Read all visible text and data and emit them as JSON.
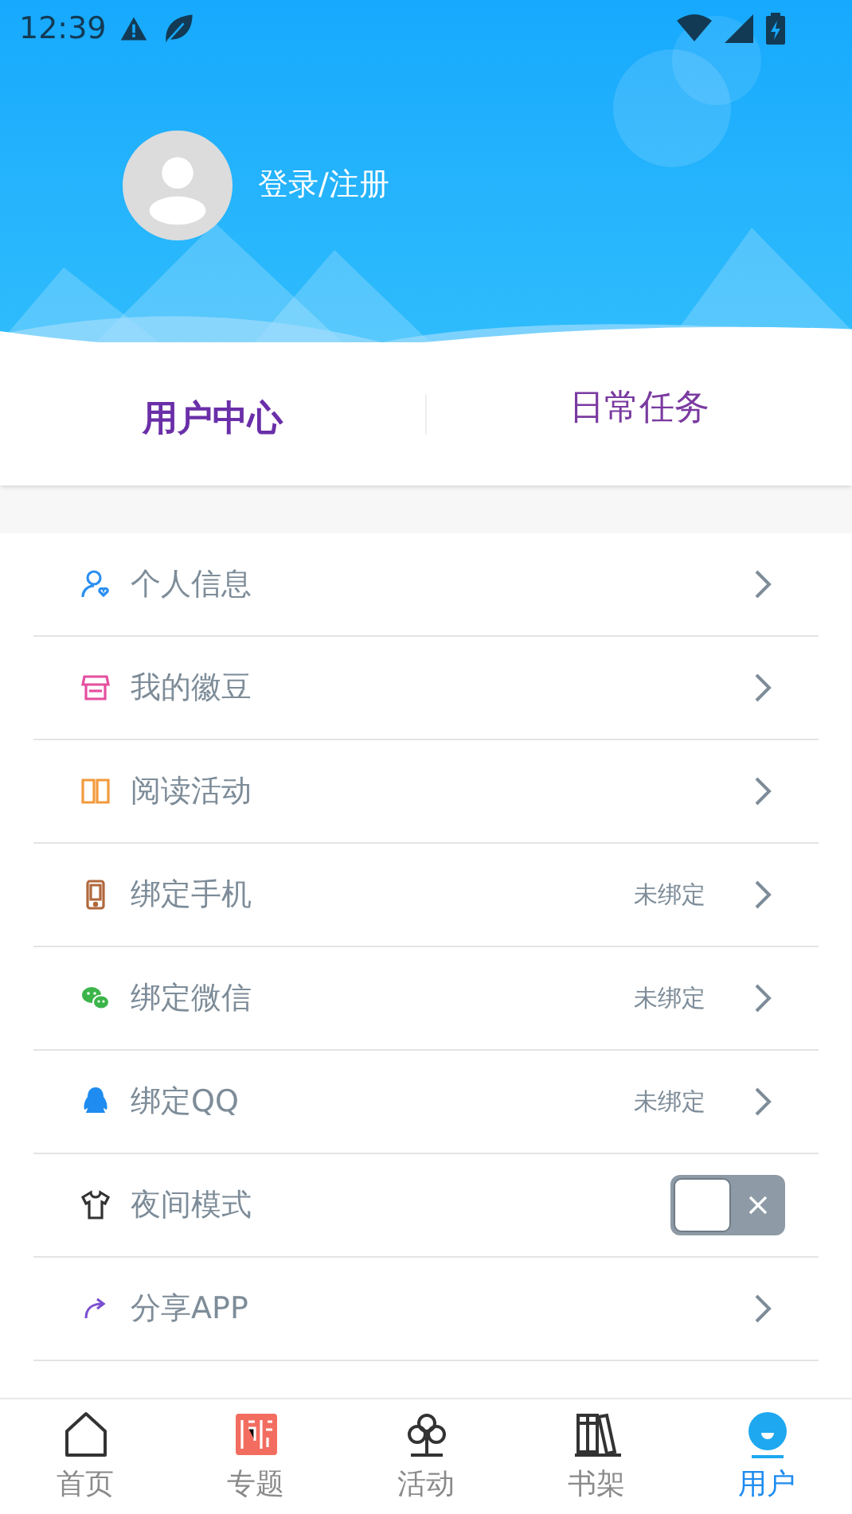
{
  "status_bar": {
    "time": "12:39"
  },
  "profile": {
    "login": "登录/注册"
  },
  "tabs": [
    {
      "label": "用户中心",
      "selected": true
    },
    {
      "label": "日常任务",
      "selected": false
    }
  ],
  "menu": [
    {
      "kind": "link",
      "label": "个人信息"
    },
    {
      "kind": "link",
      "label": "我的徽豆"
    },
    {
      "kind": "link",
      "label": "阅读活动"
    },
    {
      "kind": "link",
      "label": "绑定手机",
      "status": "未绑定"
    },
    {
      "kind": "link",
      "label": "绑定微信",
      "status": "未绑定"
    },
    {
      "kind": "link",
      "label": "绑定QQ",
      "status": "未绑定"
    },
    {
      "kind": "toggle",
      "label": "夜间模式",
      "on": false
    },
    {
      "kind": "link",
      "label": "分享APP"
    }
  ],
  "bottom_nav": [
    {
      "label": "首页",
      "selected": false
    },
    {
      "label": "专题",
      "selected": false
    },
    {
      "label": "活动",
      "selected": false
    },
    {
      "label": "书架",
      "selected": false
    },
    {
      "label": "用户",
      "selected": true
    }
  ]
}
